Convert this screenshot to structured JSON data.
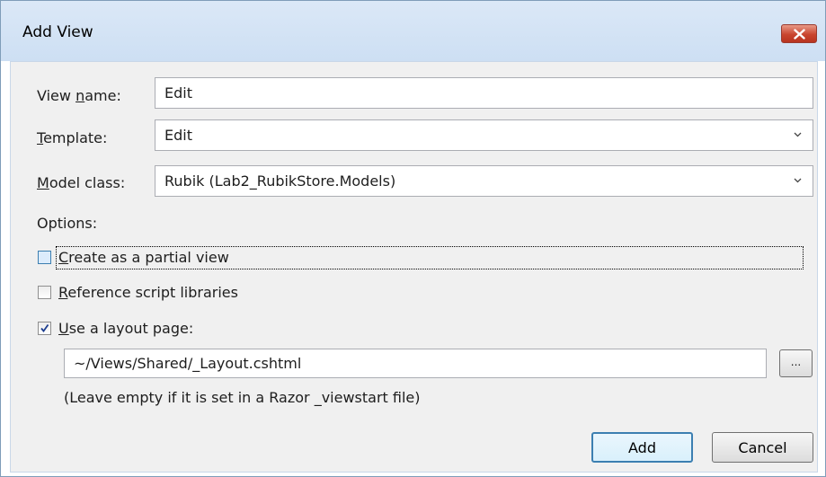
{
  "window": {
    "title": "Add View",
    "close_icon": "close-icon"
  },
  "form": {
    "view_name_label": "View name:",
    "view_name_value": "Edit",
    "template_label": "Template:",
    "template_value": "Edit",
    "model_class_label": "Model class:",
    "model_class_value": "Rubik (Lab2_RubikStore.Models)",
    "options_label": "Options:"
  },
  "options": {
    "partial_view_label": "Create as a partial view",
    "partial_view_checked": false,
    "reference_scripts_label": "Reference script libraries",
    "reference_scripts_checked": false,
    "use_layout_label": "Use a layout page:",
    "use_layout_checked": true,
    "layout_path": "~/Views/Shared/_Layout.cshtml",
    "browse_label": "...",
    "layout_hint": "(Leave empty if it is set in a Razor _viewstart file)"
  },
  "buttons": {
    "add_label": "Add",
    "cancel_label": "Cancel"
  },
  "colors": {
    "titlebar": "#cddff3",
    "client_background": "#f0f0f0",
    "close_button": "#c9452f",
    "default_button_border": "#3c7fb1"
  }
}
